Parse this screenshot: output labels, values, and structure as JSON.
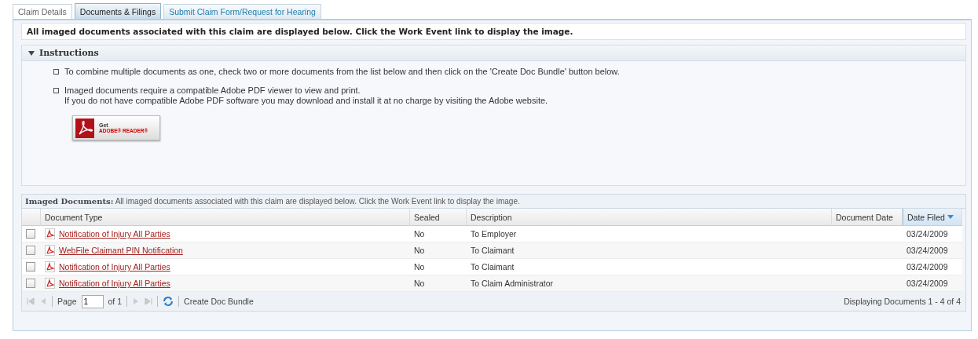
{
  "tabs": [
    {
      "label": "Claim Details",
      "selected": false
    },
    {
      "label": "Documents & Filings",
      "selected": true
    },
    {
      "label": "Submit Claim Form/Request for Hearing",
      "selected": false
    }
  ],
  "notice": "All imaged documents associated with this claim are displayed below. Click the Work Event link to display the image.",
  "instructions": {
    "title": "Instructions",
    "expanded": true,
    "items": [
      {
        "lines": [
          "To combine multiple documents as one, check two or more documents from the list below and then click on the 'Create Doc Bundle' button below."
        ]
      },
      {
        "lines": [
          "Imaged documents require a compatible Adobe PDF viewer to view and print.",
          "If you do not have compatible Adobe PDF software you may download and install it at no charge by visiting the Adobe website."
        ]
      }
    ],
    "reader_button": {
      "top": "Get",
      "bottom": "ADOBE® READER®"
    }
  },
  "grid": {
    "title": "Imaged Documents:",
    "subtitle": "All imaged documents associated with this claim are displayed below. Click the Work Event link to display the image.",
    "columns": [
      {
        "label": "Document Type",
        "sorted": false
      },
      {
        "label": "Sealed",
        "sorted": false
      },
      {
        "label": "Description",
        "sorted": false
      },
      {
        "label": "Document Date",
        "sorted": false
      },
      {
        "label": "Date Filed",
        "sorted": true
      }
    ],
    "rows": [
      {
        "checked": false,
        "type": "Notification of Injury All Parties",
        "sealed": "No",
        "description": "To Employer",
        "filed": "03/24/2009"
      },
      {
        "checked": false,
        "type": "WebFile Claimant PIN Notification",
        "sealed": "No",
        "description": "To Claimant",
        "filed": "03/24/2009"
      },
      {
        "checked": false,
        "type": "Notification of Injury All Parties",
        "sealed": "No",
        "description": "To Claimant",
        "filed": "03/24/2009"
      },
      {
        "checked": false,
        "type": "Notification of Injury All Parties",
        "sealed": "No",
        "description": "To Claim Administrator",
        "filed": "03/24/2009"
      }
    ],
    "pager": {
      "page_label": "Page",
      "page": "1",
      "of": "of 1",
      "bundle": "Create Doc Bundle",
      "status": "Displaying Documents 1 - 4 of 4"
    }
  }
}
